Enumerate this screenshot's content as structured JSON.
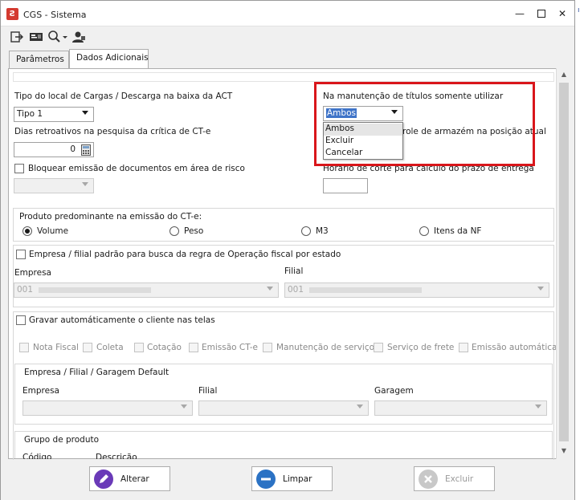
{
  "window": {
    "title": "CGS - Sistema"
  },
  "toolbar": {
    "icons": [
      "exit-icon",
      "id-card-icon",
      "search-icon",
      "user-icon"
    ]
  },
  "tabs": [
    {
      "label": "Parâmetros",
      "active": false
    },
    {
      "label": "Dados Adicionais",
      "active": true
    }
  ],
  "form": {
    "tipo_local_label": "Tipo do local de Cargas / Descarga na baixa da ACT",
    "tipo_local_value": "Tipo 1",
    "dias_label": "Dias retroativos na pesquisa da crítica de CT-e",
    "dias_value": "0",
    "bloquear_label": "Bloquear emissão de documentos em área de risco",
    "manutencao_label": "Na manutenção de títulos somente utilizar",
    "manutencao_value": "Ambos",
    "manutencao_options": [
      "Ambos",
      "Excluir",
      "Cancelar"
    ],
    "armazem_label_partial": "role de armazém na posição atual",
    "horario_label": "Horário de corte para cálculo do prazo de entrega"
  },
  "produto": {
    "title": "Produto predominante na emissão do CT-e:",
    "options": [
      "Volume",
      "Peso",
      "M3",
      "Itens da NF"
    ],
    "selected": "Volume"
  },
  "empresa_filial": {
    "checkbox_label": "Empresa / filial padrão para busca da regra de Operação fiscal por estado",
    "empresa_label": "Empresa",
    "empresa_value": "001",
    "filial_label": "Filial",
    "filial_value": "001"
  },
  "gravar": {
    "checkbox_label": "Gravar automáticamente o cliente nas telas",
    "screens": [
      "Nota Fiscal",
      "Coleta",
      "Cotação",
      "Emissão CT-e",
      "Manutenção de serviço",
      "Serviço de frete",
      "Emissão automática"
    ]
  },
  "default_group": {
    "title": "Empresa / Filial / Garagem Default",
    "empresa_label": "Empresa",
    "filial_label": "Filial",
    "garagem_label": "Garagem"
  },
  "grupo_produto": {
    "title": "Grupo de produto",
    "col_codigo": "Código",
    "col_descricao": "Descrição"
  },
  "buttons": {
    "alterar": "Alterar",
    "limpar": "Limpar",
    "excluir": "Excluir"
  },
  "colors": {
    "highlight": "#d9161b",
    "alterar_icon": "#6a3ab8",
    "limpar_icon": "#2b72c4",
    "excluir_icon": "#c8c8c8"
  }
}
